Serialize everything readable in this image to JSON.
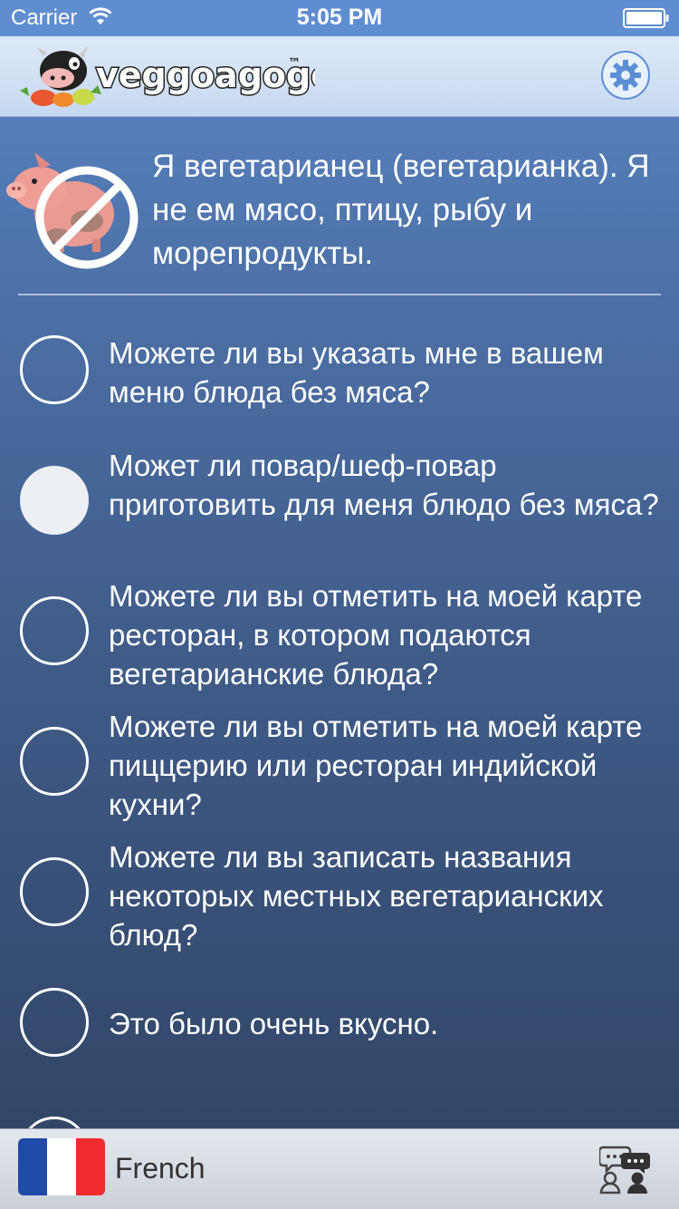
{
  "status_bar": {
    "carrier": "Carrier",
    "time": "5:05 PM"
  },
  "header": {
    "logo_text": "veggoagogo",
    "logo_tm": "™",
    "settings_icon": "gear-icon"
  },
  "intro": {
    "icon": "no-meat-icon",
    "text": "Я вегетарианец (вегетарианка). Я не ем мясо, птицу, рыбу и морепродукты."
  },
  "phrases": [
    {
      "text": "Можете ли вы указать мне в вашем меню блюда без мяса?",
      "selected": false
    },
    {
      "text": "Может ли повар/шеф-повар приготовить для меня блюдо без мяса?",
      "selected": true
    },
    {
      "text": "Можете ли вы отметить на моей карте ресторан, в котором подаются вегетарианские блюда?",
      "selected": false
    },
    {
      "text": "Можете ли вы отметить на моей карте пиццерию или ресторан индийской кухни?",
      "selected": false
    },
    {
      "text": "Можете ли вы записать названия некоторых местных вегетарианских блюд?",
      "selected": false
    },
    {
      "text": "Это было очень вкусно.",
      "selected": false
    }
  ],
  "footer": {
    "language": "French",
    "flag_icon": "france-flag-icon",
    "community_icon": "community-icon"
  },
  "colors": {
    "accent": "#5b8fd4",
    "flag_blue": "#1f4aa8",
    "flag_white": "#ffffff",
    "flag_red": "#ef2b2d"
  }
}
